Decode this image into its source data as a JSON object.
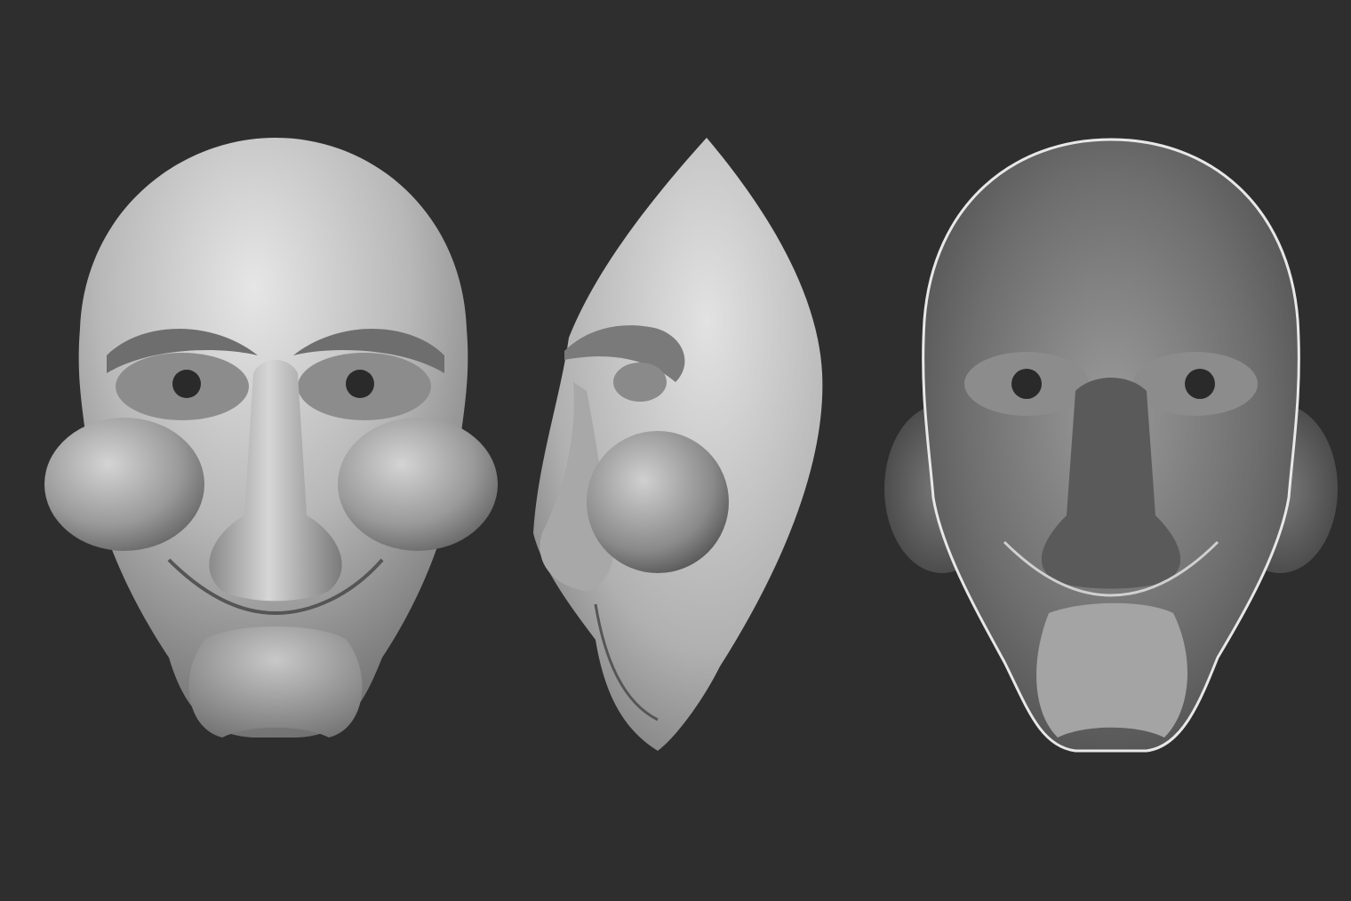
{
  "scene": {
    "background_color": "#2e2e2e",
    "views": [
      {
        "id": "front",
        "label": ""
      },
      {
        "id": "side",
        "label": ""
      },
      {
        "id": "back",
        "label": ""
      }
    ],
    "colors": {
      "clay_light": "#dcdcdc",
      "clay_mid": "#9e9e9e",
      "clay_dark": "#4a4a4a",
      "eye_hole": "#2a2a2a"
    }
  }
}
